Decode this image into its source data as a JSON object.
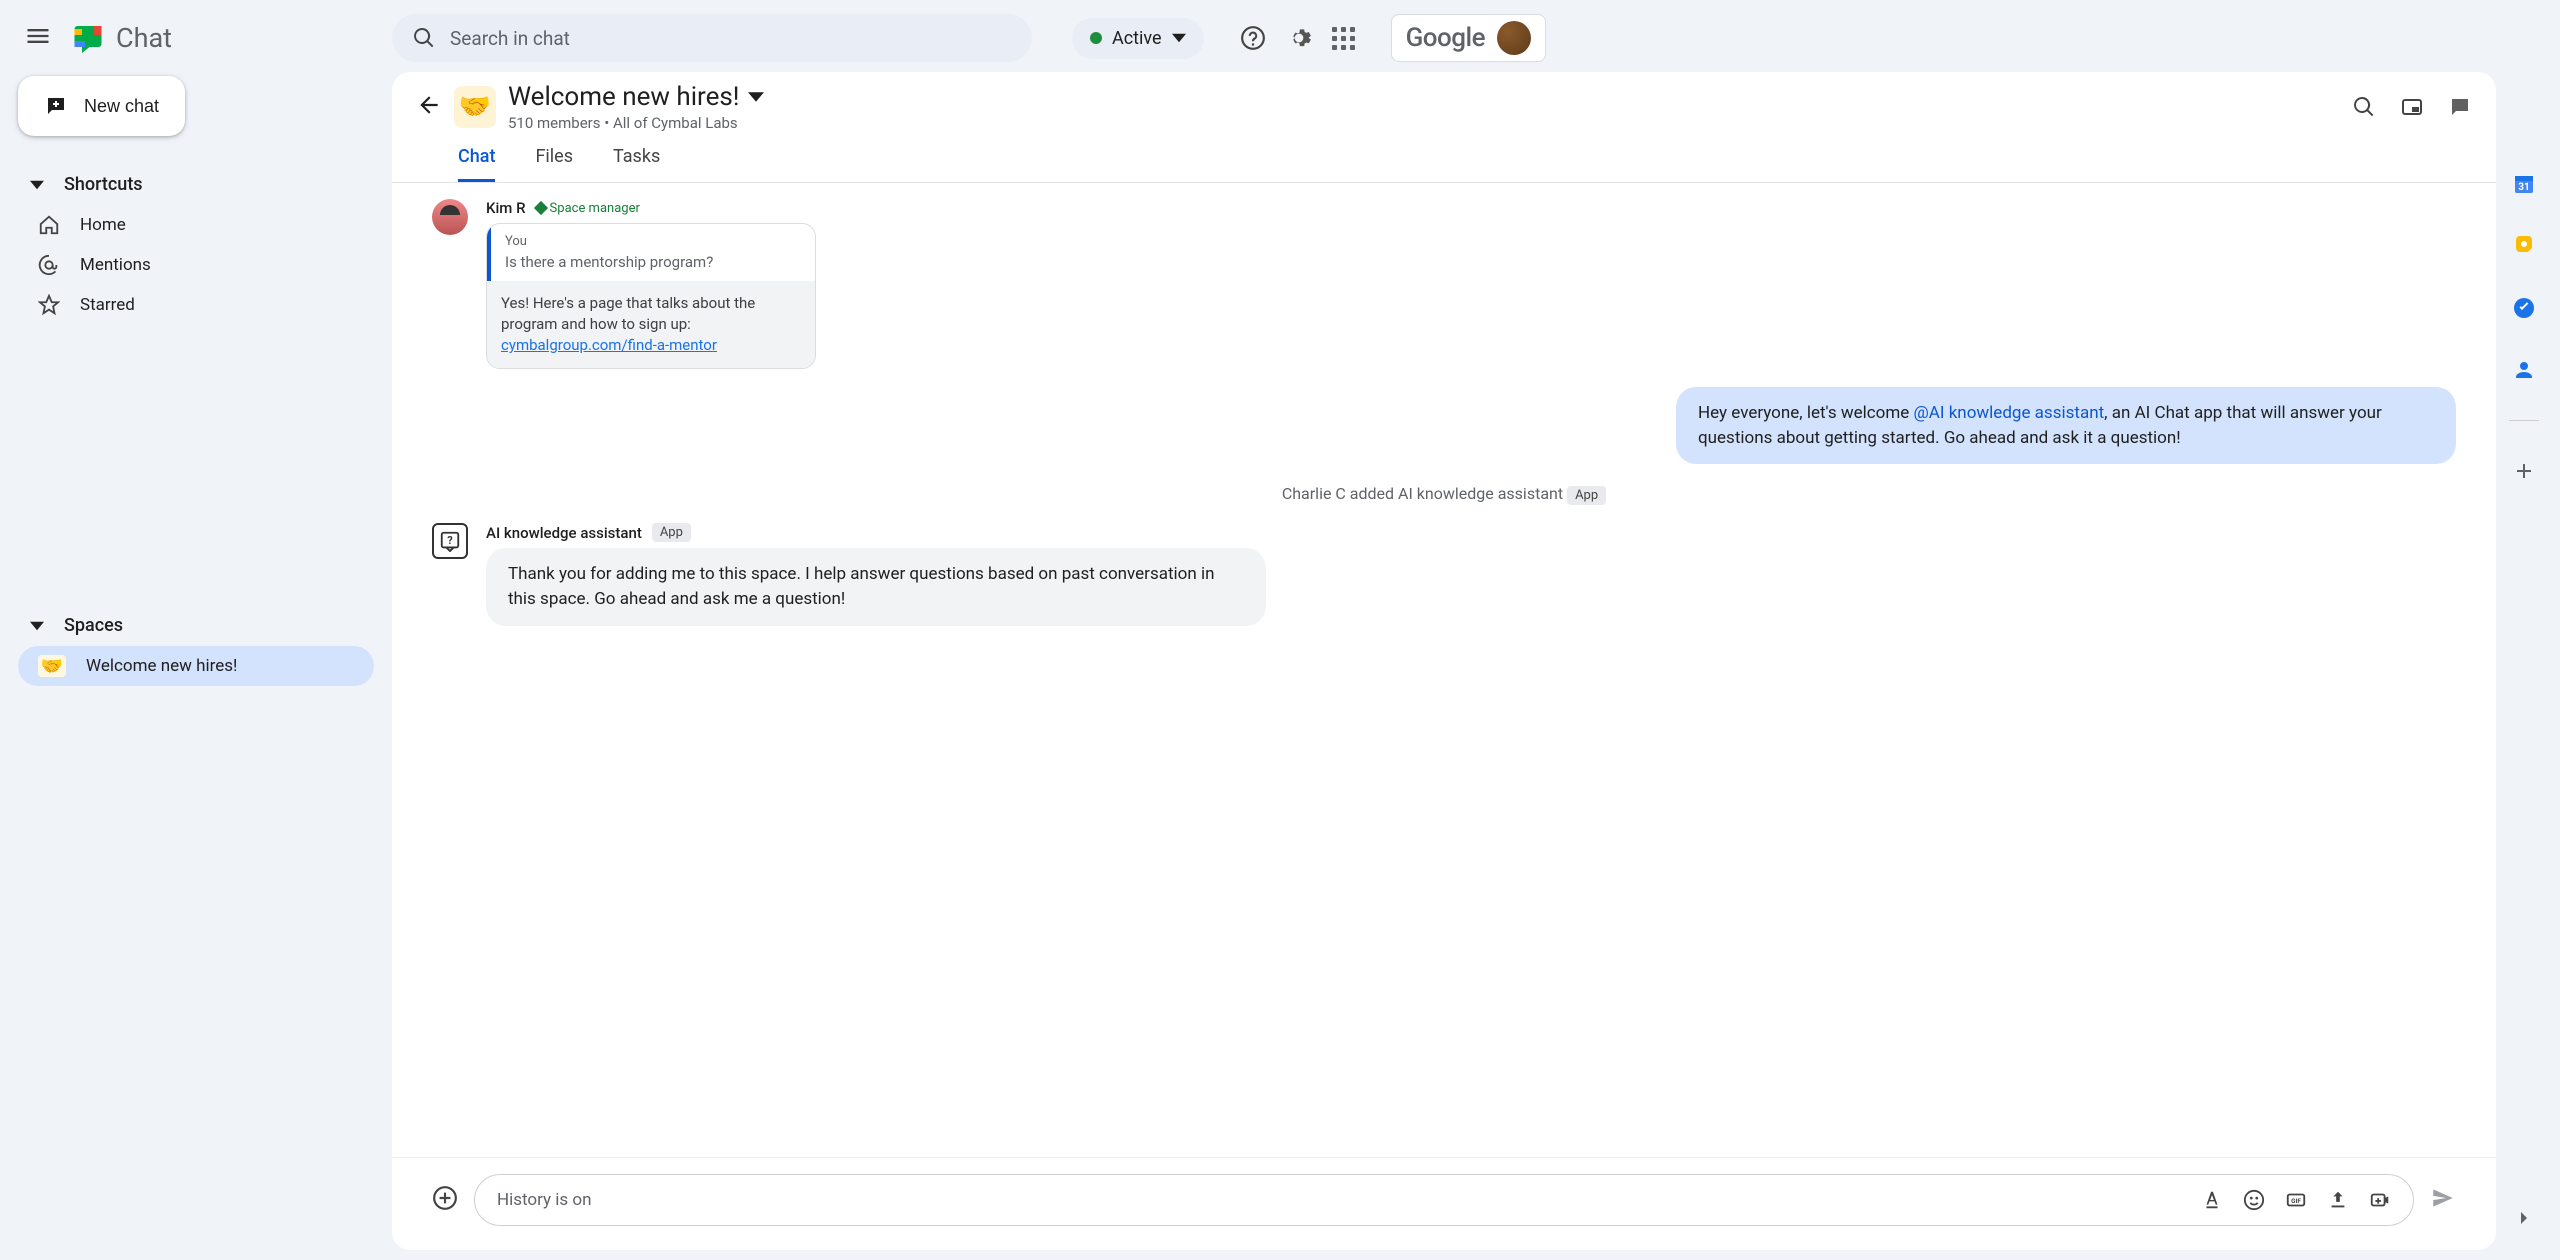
{
  "header": {
    "app_name": "Chat",
    "search_placeholder": "Search in chat",
    "status": "Active",
    "google": "Google"
  },
  "leftnav": {
    "new_chat": "New chat",
    "shortcuts_label": "Shortcuts",
    "shortcuts": [
      {
        "label": "Home"
      },
      {
        "label": "Mentions"
      },
      {
        "label": "Starred"
      }
    ],
    "spaces_label": "Spaces",
    "spaces": [
      {
        "label": "Welcome new hires!",
        "emoji": "🤝",
        "active": true
      }
    ]
  },
  "space": {
    "title": "Welcome new hires!",
    "emoji": "🤝",
    "subtitle": "510 members  •  All of Cymbal Labs",
    "tabs": [
      "Chat",
      "Files",
      "Tasks"
    ],
    "active_tab": 0
  },
  "messages": {
    "kim": {
      "author": "Kim R",
      "role": "Space manager",
      "quote_from": "You",
      "quote_text": "Is there a mentorship program?",
      "reply_text": "Yes! Here's a page that talks about the program and how to sign up: ",
      "reply_link": "cymbalgroup.com/find-a-mentor"
    },
    "own": {
      "pre": "Hey everyone, let's welcome ",
      "mention": "@AI knowledge assistant",
      "post": ", an AI Chat app that will answer your questions about getting started.  Go ahead and ask it a question!"
    },
    "system": {
      "text": "Charlie C added AI knowledge assistant",
      "badge": "App"
    },
    "bot": {
      "author": "AI knowledge assistant",
      "badge": "App",
      "text": "Thank you for adding me to this space. I help answer questions based on past conversation in this space. Go ahead and ask me a question!"
    }
  },
  "composer": {
    "placeholder": "History is on"
  }
}
